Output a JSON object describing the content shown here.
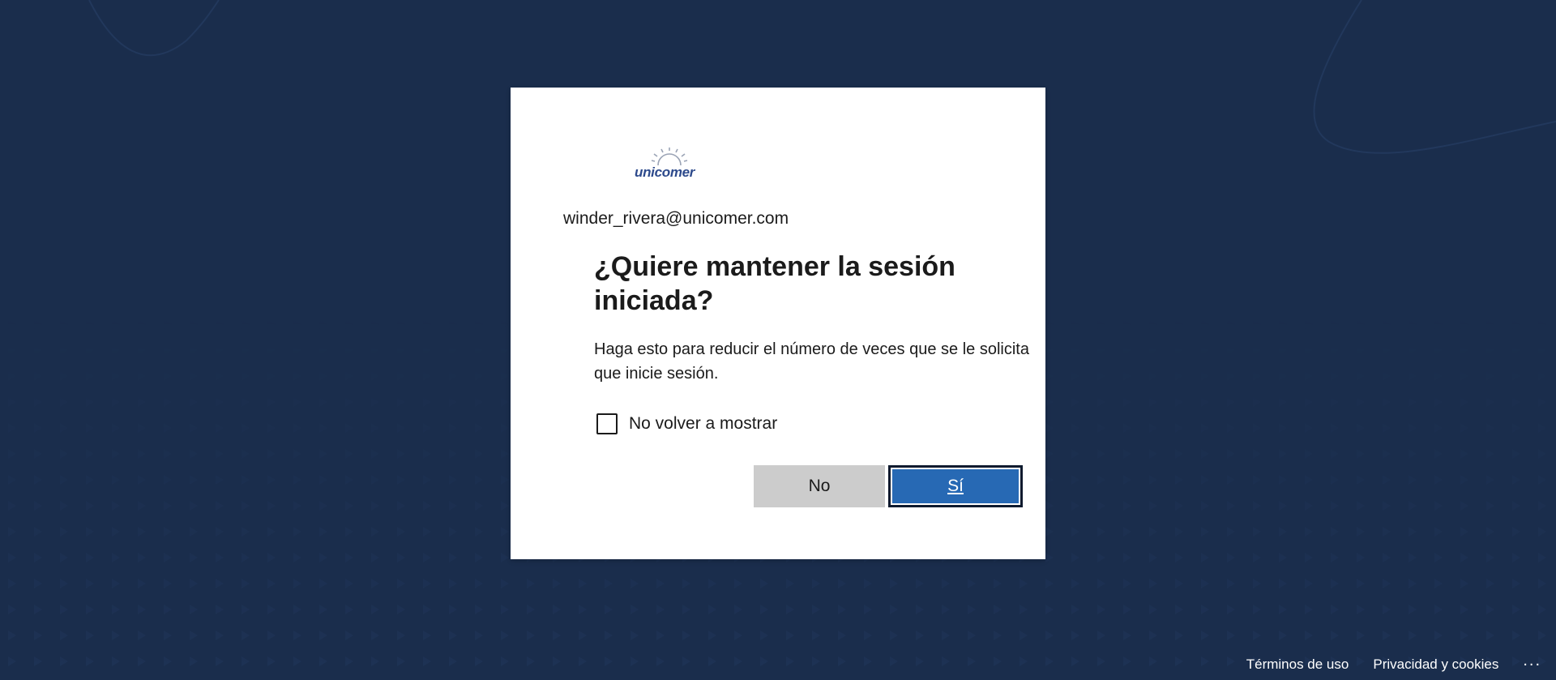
{
  "brand": {
    "logo_text": "unicomer",
    "logo_icon": "sun-rays-icon",
    "accent_color": "#2769b4",
    "background_color": "#1a2d4c"
  },
  "account": {
    "email": "winder_rivera@unicomer.com"
  },
  "prompt": {
    "title": "¿Quiere mantener la sesión iniciada?",
    "description": "Haga esto para reducir el número de veces que se le solicita que inicie sesión.",
    "checkbox_label": "No volver a mostrar",
    "checkbox_checked": false
  },
  "buttons": {
    "no_label": "No",
    "yes_label": "Sí"
  },
  "footer": {
    "terms_label": "Términos de uso",
    "privacy_label": "Privacidad y cookies",
    "more_label": "..."
  }
}
